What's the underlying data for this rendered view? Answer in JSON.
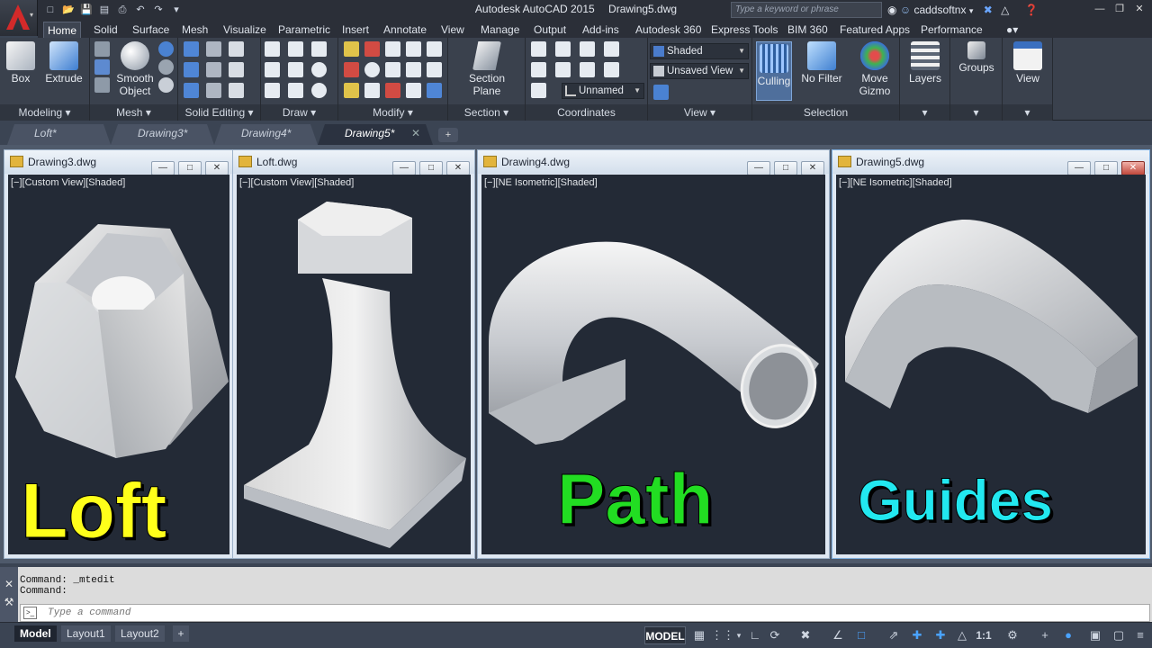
{
  "title": {
    "app": "Autodesk AutoCAD 2015",
    "file": "Drawing5.dwg"
  },
  "search": {
    "placeholder": "Type a keyword or phrase"
  },
  "user": {
    "name": "caddsoftnx"
  },
  "ribbon_tabs": [
    "Home",
    "Solid",
    "Surface",
    "Mesh",
    "Visualize",
    "Parametric",
    "Insert",
    "Annotate",
    "View",
    "Manage",
    "Output",
    "Add-ins",
    "Autodesk 360",
    "Express Tools",
    "BIM 360",
    "Featured Apps",
    "Performance"
  ],
  "ribbon": {
    "box": "Box",
    "extrude": "Extrude",
    "smooth_object_1": "Smooth",
    "smooth_object_2": "Object",
    "section_plane_1": "Section",
    "section_plane_2": "Plane",
    "visual_style": "Shaded",
    "saved_view": "Unsaved View",
    "ucs_name": "Unnamed",
    "culling": "Culling",
    "no_filter": "No Filter",
    "move_gizmo_1": "Move",
    "move_gizmo_2": "Gizmo",
    "layers": "Layers",
    "groups": "Groups",
    "view": "View"
  },
  "panels": {
    "modeling": "Modeling",
    "mesh": "Mesh",
    "solid_editing": "Solid Editing",
    "draw": "Draw",
    "modify": "Modify",
    "section": "Section",
    "coordinates": "Coordinates",
    "view": "View",
    "selection": "Selection"
  },
  "file_tabs": [
    "Loft*",
    "Drawing3*",
    "Drawing4*",
    "Drawing5*"
  ],
  "windows": [
    {
      "title": "Drawing3.dwg",
      "viewport_label": "[−][Custom View][Shaded]"
    },
    {
      "title": "Loft.dwg",
      "viewport_label": "[−][Custom View][Shaded]"
    },
    {
      "title": "Drawing4.dwg",
      "viewport_label": "[−][NE Isometric][Shaded]"
    },
    {
      "title": "Drawing5.dwg",
      "viewport_label": "[−][NE Isometric][Shaded]"
    }
  ],
  "overlay_labels": {
    "loft": "Loft",
    "path": "Path",
    "guides": "Guides"
  },
  "overlay_colors": {
    "loft": "#ffff1a",
    "path": "#22dd22",
    "guides": "#22e8f0"
  },
  "command": {
    "history": [
      "Command:  _mtedit",
      "Command:"
    ],
    "placeholder": "Type a command"
  },
  "layout_tabs": [
    "Model",
    "Layout1",
    "Layout2"
  ],
  "status": {
    "model": "MODEL",
    "scale": "1:1"
  }
}
